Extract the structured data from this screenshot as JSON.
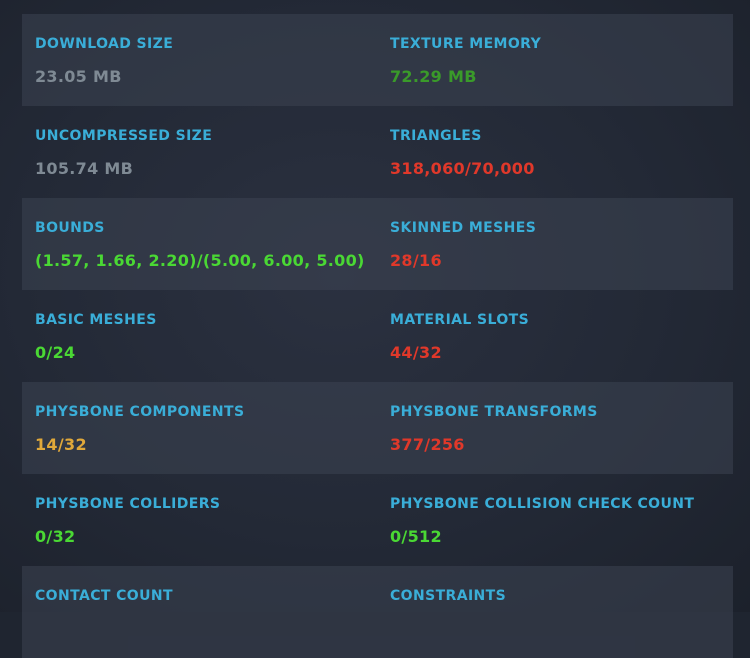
{
  "colors": {
    "label": "#3aaed8",
    "neutral": "#7f8a94",
    "good_dark": "#3a9a2a",
    "good": "#4ad834",
    "warn": "#e0a83a",
    "bad": "#e0382a"
  },
  "stats": [
    {
      "left": {
        "label": "DOWNLOAD SIZE",
        "value": "23.05 MB",
        "status": "neutral"
      },
      "right": {
        "label": "TEXTURE MEMORY",
        "value": "72.29 MB",
        "status": "good_dark"
      }
    },
    {
      "left": {
        "label": "UNCOMPRESSED SIZE",
        "value": "105.74 MB",
        "status": "neutral"
      },
      "right": {
        "label": "TRIANGLES",
        "value": "318,060/70,000",
        "status": "bad"
      }
    },
    {
      "left": {
        "label": "BOUNDS",
        "value": "(1.57, 1.66, 2.20)/(5.00, 6.00, 5.00)",
        "status": "good"
      },
      "right": {
        "label": "SKINNED MESHES",
        "value": "28/16",
        "status": "bad"
      }
    },
    {
      "left": {
        "label": "BASIC MESHES",
        "value": "0/24",
        "status": "good"
      },
      "right": {
        "label": "MATERIAL SLOTS",
        "value": "44/32",
        "status": "bad"
      }
    },
    {
      "left": {
        "label": "PHYSBONE COMPONENTS",
        "value": "14/32",
        "status": "warn"
      },
      "right": {
        "label": "PHYSBONE TRANSFORMS",
        "value": "377/256",
        "status": "bad"
      }
    },
    {
      "left": {
        "label": "PHYSBONE COLLIDERS",
        "value": "0/32",
        "status": "good"
      },
      "right": {
        "label": "PHYSBONE COLLISION CHECK COUNT",
        "value": "0/512",
        "status": "good"
      }
    },
    {
      "left": {
        "label": "CONTACT COUNT",
        "value": "",
        "status": "good"
      },
      "right": {
        "label": "CONSTRAINTS",
        "value": "",
        "status": "good"
      }
    }
  ]
}
